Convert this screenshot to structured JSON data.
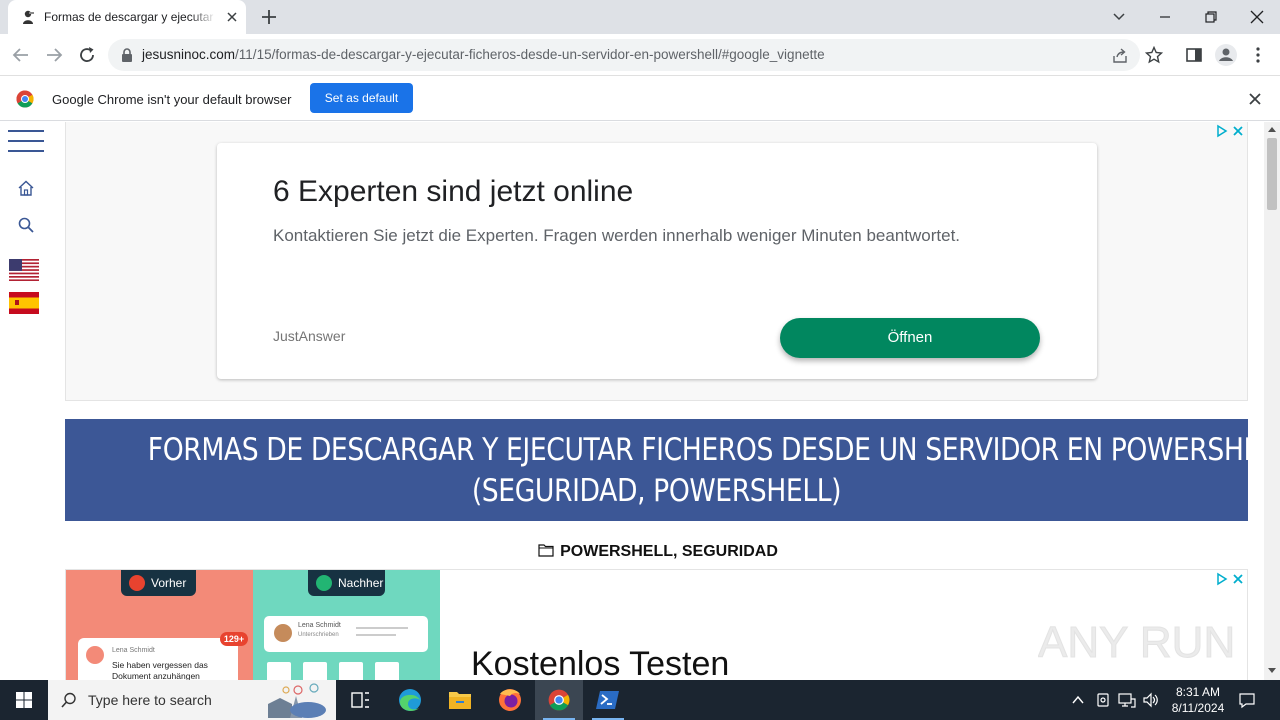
{
  "browser": {
    "tab_title": "Formas de descargar y ejecutar f",
    "url_host": "jesusninoc.com",
    "url_path": "/11/15/formas-de-descargar-y-ejecutar-ficheros-desde-un-servidor-en-powershell/#google_vignette"
  },
  "infobar": {
    "message": "Google Chrome isn't your default browser",
    "button_label": "Set as default"
  },
  "ad1": {
    "headline": "6 Experten sind jetzt online",
    "body": "Kontaktieren Sie jetzt die Experten. Fragen werden innerhalb weniger Minuten beantwortet.",
    "advertiser": "JustAnswer",
    "cta_label": "Öffnen"
  },
  "article": {
    "title_line1": "FORMAS DE DESCARGAR Y EJECUTAR FICHEROS DESDE UN SERVIDOR EN POWERSHELL",
    "title_line2": "(SEGURIDAD, POWERSHELL)",
    "categories": "POWERSHELL, SEGURIDAD"
  },
  "ad2": {
    "before_label": "Vorher",
    "after_label": "Nachher",
    "badge": "129+",
    "before_sender": "Lena Schmidt",
    "before_text": "Sie haben vergessen das Dokument anzuhängen",
    "after_sender": "Lena Schmidt",
    "after_sub": "Unterschrieben",
    "headline": "Kostenlos Testen"
  },
  "watermark": "ANY RUN",
  "taskbar": {
    "search_placeholder": "Type here to search",
    "time": "8:31 AM",
    "date": "8/11/2024"
  },
  "colors": {
    "banner": "#3c5796",
    "cta_green": "#01875f",
    "chrome_blue": "#1a73e8",
    "taskbar": "#1b2530"
  }
}
